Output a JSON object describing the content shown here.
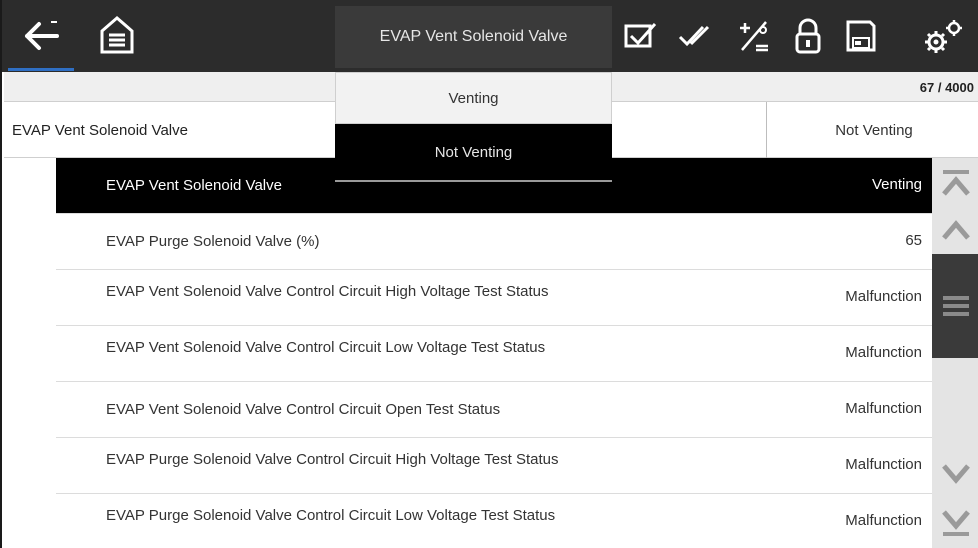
{
  "toolbar": {
    "title": "EVAP Vent Solenoid Valve",
    "icons": [
      "back-arrow-icon",
      "home-icon",
      "check-select-icon",
      "double-check-icon",
      "percent-graph-icon",
      "lock-icon",
      "save-icon",
      "settings-gear-icon"
    ],
    "accent_color": "#2f6fc4"
  },
  "header": {
    "counter": "67 / 4000"
  },
  "selected_pid": {
    "name": "EVAP Vent Solenoid Valve",
    "value": "Not Venting"
  },
  "dropdown": {
    "options": [
      "Venting",
      "Not Venting"
    ],
    "selected": "Not Venting"
  },
  "list": {
    "rows": [
      {
        "label": "EVAP Vent Solenoid Valve",
        "value": "Venting"
      },
      {
        "label": "EVAP Purge Solenoid Valve (%)",
        "value": "65"
      },
      {
        "label": "EVAP Vent Solenoid Valve Control Circuit High Voltage Test Status",
        "value": "Malfunction"
      },
      {
        "label": "EVAP Vent Solenoid Valve Control Circuit Low Voltage Test Status",
        "value": "Malfunction"
      },
      {
        "label": "EVAP Vent Solenoid Valve Control Circuit Open Test Status",
        "value": "Malfunction"
      },
      {
        "label": "EVAP Purge Solenoid Valve Control Circuit High Voltage Test Status",
        "value": "Malfunction"
      },
      {
        "label": "EVAP Purge Solenoid Valve Control Circuit Low Voltage Test Status",
        "value": "Malfunction"
      }
    ]
  },
  "scrollbar": {
    "icons": [
      "double-chevron-up-icon",
      "chevron-up-icon",
      "menu-grip-icon",
      "chevron-down-icon",
      "double-chevron-down-icon"
    ]
  }
}
